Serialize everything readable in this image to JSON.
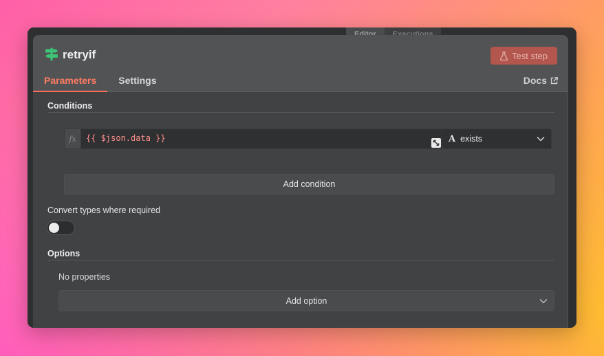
{
  "back_tabs": [
    "Editor",
    "Executions"
  ],
  "node": {
    "title": "retryif",
    "icon": "signpost-icon",
    "accent_color": "#3dc476"
  },
  "header": {
    "test_step_label": "Test step",
    "tabs": [
      {
        "label": "Parameters",
        "active": true
      },
      {
        "label": "Settings",
        "active": false
      }
    ],
    "docs_label": "Docs"
  },
  "conditions": {
    "section_title": "Conditions",
    "expression_prefix": "fx",
    "expression_value": "{{ $json.data }}",
    "operator_type_icon": "A",
    "operator_label": "exists",
    "add_condition_label": "Add condition"
  },
  "convert_types": {
    "label": "Convert types where required",
    "enabled": false
  },
  "options": {
    "section_title": "Options",
    "empty_text": "No properties",
    "add_option_label": "Add option"
  },
  "colors": {
    "accent": "#ff6d5a",
    "test_button": "#b3564e"
  }
}
